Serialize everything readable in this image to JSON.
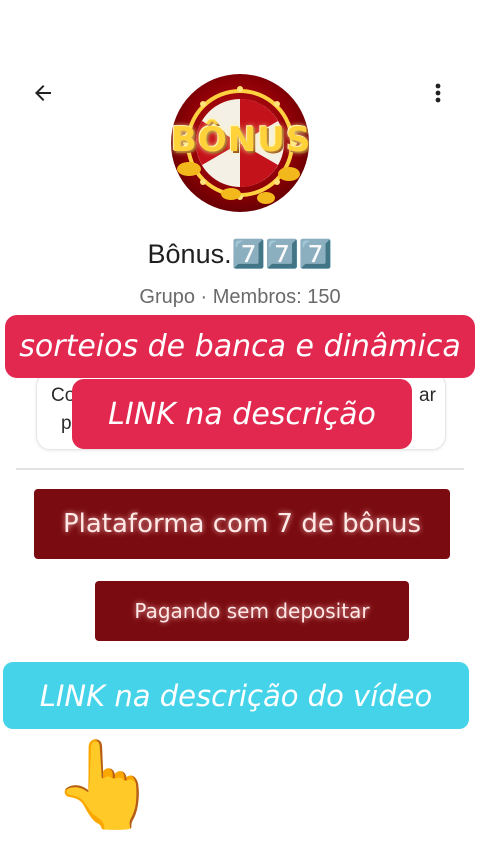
{
  "header": {
    "back_icon": "arrow-left-icon",
    "menu_icon": "more-vertical-icon"
  },
  "group": {
    "avatar_text": "BÔNUS",
    "name": "Bônus.7️⃣7️⃣7️⃣",
    "subtitle": "Grupo · Membros: 150",
    "description_left": "Co",
    "description_left2": "p",
    "description_right": "ar"
  },
  "overlays": {
    "banner1": "sorteios de banca e dinâmica",
    "banner2": "LINK na descrição",
    "banner3": "Plataforma com 7 de bônus",
    "banner4": "Pagando sem depositar",
    "banner5": "LINK na descrição do vídeo",
    "pointer_icon": "👆"
  },
  "colors": {
    "pink": "#e3284f",
    "dark_red": "#7a0b10",
    "cyan": "#45d3ea"
  }
}
